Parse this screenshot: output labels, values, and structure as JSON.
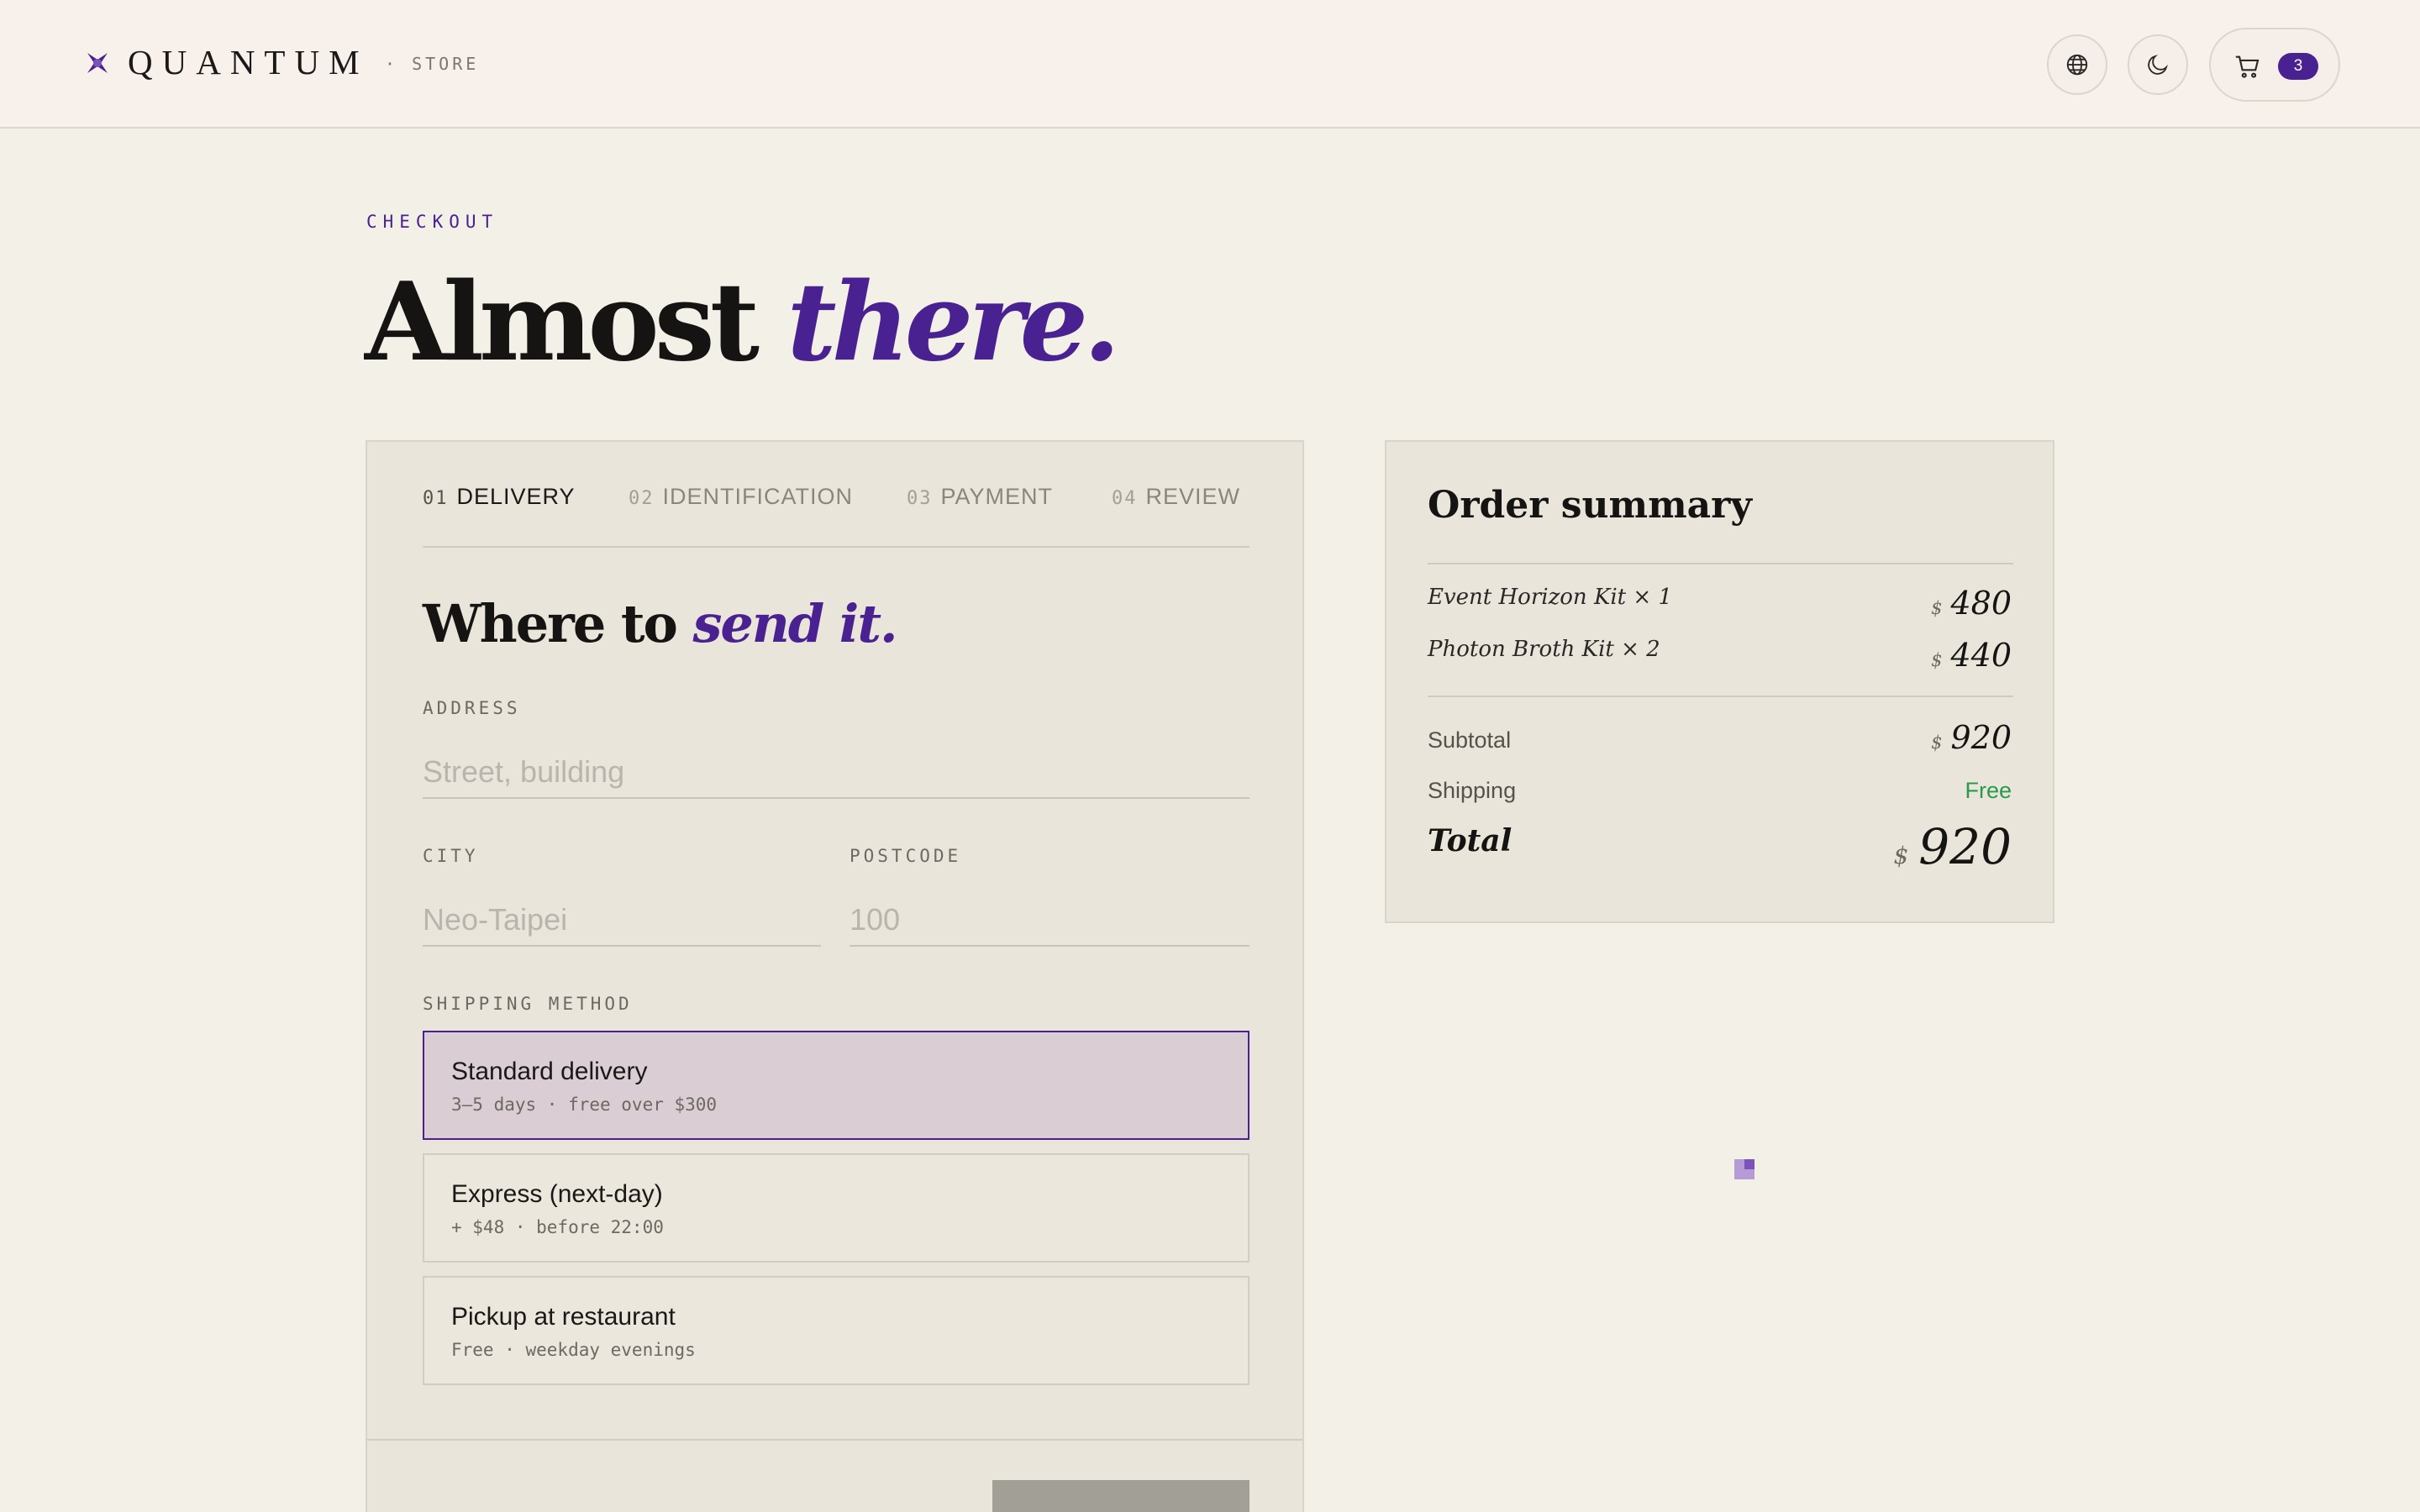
{
  "header": {
    "brand": "QUANTUM",
    "store_tag": "· STORE",
    "cart_count": "3",
    "icons": [
      "globe-icon",
      "moon-icon",
      "cart-icon"
    ]
  },
  "page": {
    "eyebrow": "CHECKOUT",
    "title_plain": "Almost",
    "title_accent": "there."
  },
  "steps": [
    {
      "num": "01",
      "label": "DELIVERY",
      "active": true
    },
    {
      "num": "02",
      "label": "IDENTIFICATION",
      "active": false
    },
    {
      "num": "03",
      "label": "PAYMENT",
      "active": false
    },
    {
      "num": "04",
      "label": "REVIEW",
      "active": false
    }
  ],
  "delivery": {
    "title_plain": "Where to",
    "title_accent": "send it.",
    "address": {
      "label": "ADDRESS",
      "value": "",
      "placeholder": "Street, building"
    },
    "city": {
      "label": "CITY",
      "value": "",
      "placeholder": "Neo-Taipei"
    },
    "postcode": {
      "label": "POSTCODE",
      "value": "",
      "placeholder": "100"
    },
    "shipping_label": "SHIPPING METHOD",
    "shipping_options": [
      {
        "title": "Standard delivery",
        "subtitle": "3–5 days · free over $300",
        "selected": true
      },
      {
        "title": "Express (next-day)",
        "subtitle": "+ $48 · before 22:00",
        "selected": false
      },
      {
        "title": "Pickup at restaurant",
        "subtitle": "Free · weekday evenings",
        "selected": false
      }
    ]
  },
  "summary": {
    "title": "Order summary",
    "currency": "$",
    "items": [
      {
        "name": "Event Horizon Kit × 1",
        "price": "480"
      },
      {
        "name": "Photon Broth Kit × 2",
        "price": "440"
      }
    ],
    "subtotal_label": "Subtotal",
    "subtotal": "920",
    "shipping_label": "Shipping",
    "shipping_value": "Free",
    "total_label": "Total",
    "total": "920"
  },
  "colors": {
    "accent": "#4a2190",
    "background": "#f3f0e8",
    "card": "#e9e5da",
    "selected_option": "#dacdd3",
    "free_green": "#2a9a4a"
  }
}
